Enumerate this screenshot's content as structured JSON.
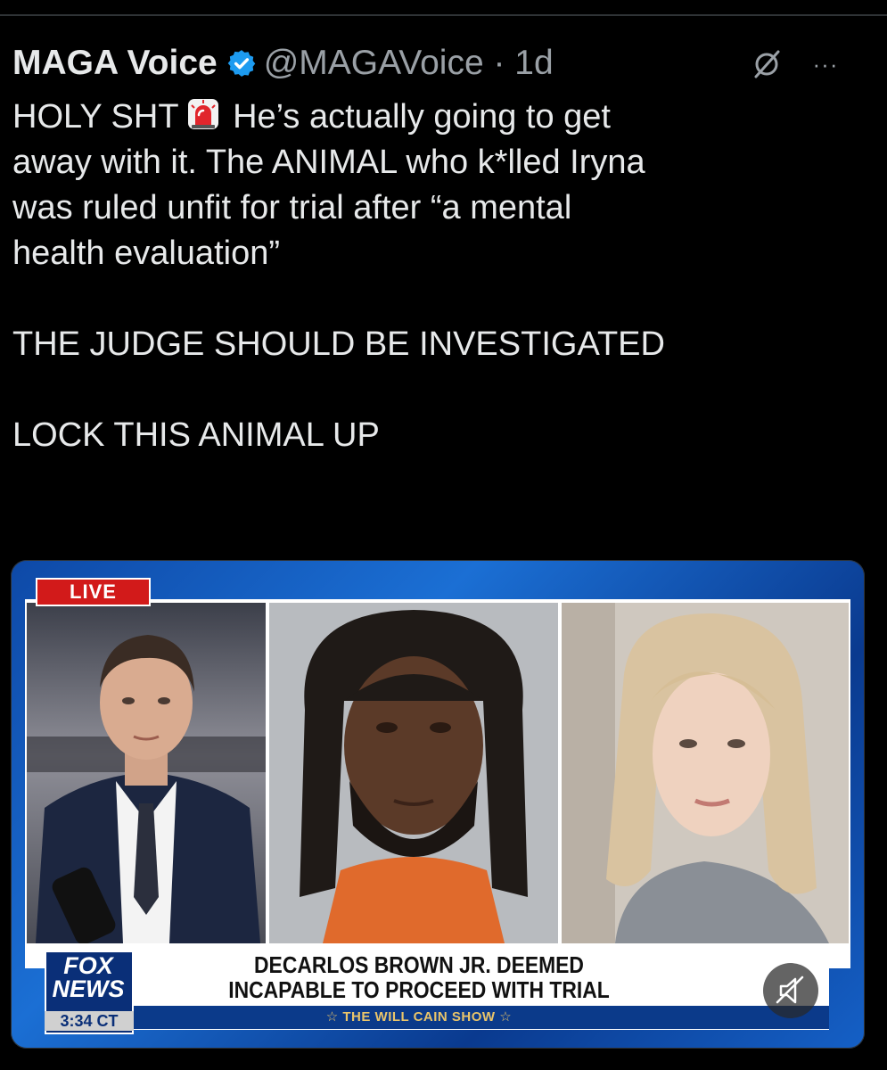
{
  "tweet": {
    "display_name": "MAGA Voice",
    "handle_time": "@MAGAVoice · 1d",
    "text_line1_a": "HOLY SHT",
    "text_line1_b": "He’s actually going to get",
    "text_line2": "away with it. The ANIMAL who k*lled Iryna",
    "text_line3": "was ruled unfit for trial after “a mental",
    "text_line4": "health evaluation”",
    "text_para2": "THE JUDGE SHOULD BE INVESTIGATED",
    "text_para3": "LOCK THIS ANIMAL UP",
    "more_label": "···"
  },
  "icons": {
    "verified": "verified-badge-icon",
    "siren": "police-siren-icon",
    "grok": "grok-icon",
    "more": "more-options-icon",
    "mute": "muted-speaker-icon"
  },
  "media": {
    "live_label": "LIVE",
    "chyron_line1": "DECARLOS BROWN JR. DEEMED",
    "chyron_line2": "INCAPABLE TO PROCEED WITH TRIAL",
    "show_name": "☆ THE WILL CAIN SHOW ☆",
    "logo_text": "FOX NEWS",
    "logo_time": "3:34 CT"
  },
  "colors": {
    "background": "#000000",
    "text": "#e7e9ea",
    "secondary": "#9aa0a6",
    "verified": "#1d9bf0",
    "fox_blue": "#0a3a8f",
    "live_red": "#d21a1a"
  }
}
